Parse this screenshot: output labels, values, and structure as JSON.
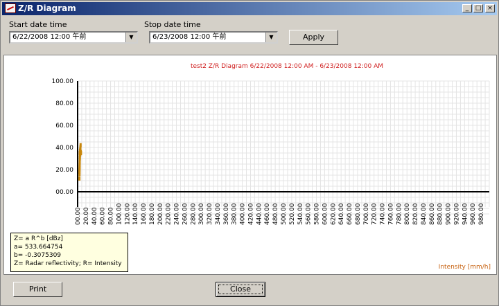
{
  "window": {
    "title": "Z/R Diagram",
    "controls": [
      "_",
      "□",
      "×"
    ]
  },
  "filters": {
    "start_label": "Start date time",
    "start_value": "6/22/2008 12:00 午前",
    "stop_label": "Stop date time",
    "stop_value": "6/23/2008 12:00 午前",
    "apply_label": "Apply"
  },
  "chart_data": {
    "type": "scatter",
    "title": "test2 Z/R Diagram 6/22/2008 12:00 AM - 6/23/2008 12:00 AM",
    "xlabel": "Intensity [mm/h]",
    "ylabel": "",
    "xlim": [
      0,
      1000
    ],
    "ylim": [
      0,
      100
    ],
    "y_ticks": [
      "00.00",
      "20.00",
      "40.00",
      "60.00",
      "80.00",
      "100.00"
    ],
    "x_ticks": [
      "00.00",
      "20.00",
      "40.00",
      "60.00",
      "80.00",
      "100.00",
      "120.00",
      "140.00",
      "160.00",
      "180.00",
      "200.00",
      "220.00",
      "240.00",
      "260.00",
      "280.00",
      "300.00",
      "320.00",
      "340.00",
      "360.00",
      "380.00",
      "400.00",
      "420.00",
      "440.00",
      "460.00",
      "480.00",
      "500.00",
      "520.00",
      "540.00",
      "560.00",
      "580.00",
      "600.00",
      "620.00",
      "640.00",
      "660.00",
      "680.00",
      "700.00",
      "720.00",
      "740.00",
      "760.00",
      "780.00",
      "800.00",
      "820.00",
      "840.00",
      "860.00",
      "880.00",
      "900.00",
      "920.00",
      "940.00",
      "960.00",
      "980.00"
    ],
    "grid": true,
    "series": [
      {
        "color": "#c8860a",
        "points": [
          [
            0.2,
            12
          ],
          [
            0.4,
            16
          ],
          [
            0.5,
            20
          ],
          [
            0.7,
            24
          ],
          [
            0.9,
            27
          ],
          [
            1.1,
            30
          ],
          [
            1.3,
            33
          ],
          [
            1.6,
            36
          ],
          [
            2.0,
            38
          ],
          [
            2.5,
            40
          ],
          [
            3.0,
            42
          ],
          [
            1.0,
            35
          ],
          [
            1.5,
            37
          ],
          [
            2.2,
            34
          ],
          [
            3.5,
            36
          ],
          [
            4.0,
            35
          ],
          [
            0.3,
            18
          ],
          [
            0.6,
            22
          ],
          [
            0.8,
            26
          ],
          [
            1.2,
            31
          ]
        ]
      }
    ],
    "title_color": "#d02020",
    "xlabel_color": "#c86414"
  },
  "legend": {
    "lines": [
      "Z= a R^b [dBz]",
      "a= 533.664754",
      "b= -0.3075309",
      "Z= Radar reflectivity; R= Intensity"
    ]
  },
  "footer": {
    "print_label": "Print",
    "close_label": "Close"
  }
}
